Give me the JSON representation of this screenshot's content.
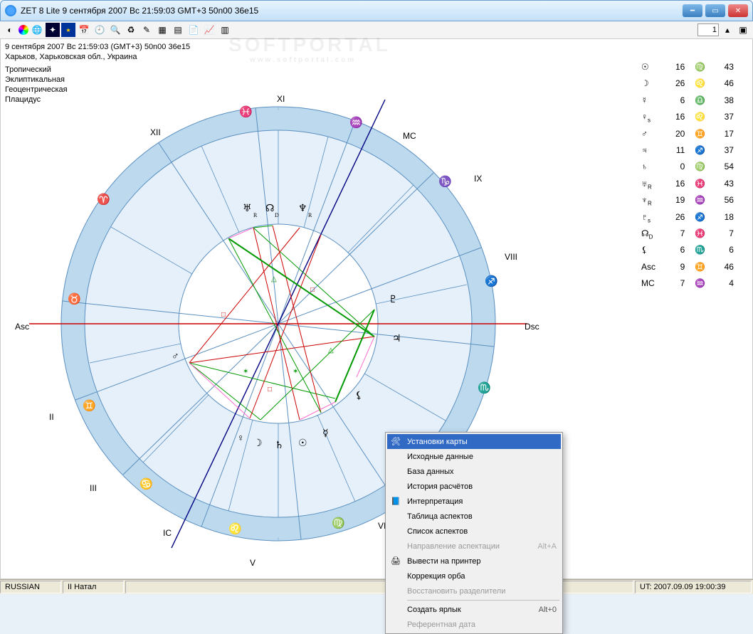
{
  "window": {
    "title": "ZET 8 Lite    9 сентября 2007   Вс   21:59:03 GMT+3 50n00  36e15"
  },
  "toolbar": {
    "page_number": "1"
  },
  "info": {
    "line1": "9 сентября 2007  Вс  21:59:03 (GMT+3)  50n00  36e15",
    "line2": "Харьков, Харьковская обл., Украина",
    "settings": [
      "Тропический",
      "Эклиптикальная",
      "Геоцентрическая",
      "Плацидус"
    ]
  },
  "watermark": {
    "big": "SOFTPORTAL",
    "sub": "www.softportal.com"
  },
  "labels": {
    "asc": "Asc",
    "dsc": "Dsc",
    "mc": "MC",
    "ic": "IC",
    "houses": {
      "II": "II",
      "III": "III",
      "V": "V",
      "VI": "VI",
      "VIII": "VIII",
      "IX": "IX",
      "XI": "XI",
      "XII": "XII"
    }
  },
  "planet_positions": [
    {
      "sym": "☉",
      "sub": "",
      "deg": "16",
      "sign": "♍",
      "min": "43"
    },
    {
      "sym": "☽",
      "sub": "",
      "deg": "26",
      "sign": "♌",
      "min": "46"
    },
    {
      "sym": "☿",
      "sub": "",
      "deg": "6",
      "sign": "♎",
      "min": "38"
    },
    {
      "sym": "♀",
      "sub": "s",
      "deg": "16",
      "sign": "♌",
      "min": "37"
    },
    {
      "sym": "♂",
      "sub": "",
      "deg": "20",
      "sign": "♊",
      "min": "17"
    },
    {
      "sym": "♃",
      "sub": "",
      "deg": "11",
      "sign": "♐",
      "min": "37"
    },
    {
      "sym": "♄",
      "sub": "",
      "deg": "0",
      "sign": "♍",
      "min": "54"
    },
    {
      "sym": "♅",
      "sub": "R",
      "deg": "16",
      "sign": "♓",
      "min": "43"
    },
    {
      "sym": "♆",
      "sub": "R",
      "deg": "19",
      "sign": "♒",
      "min": "56"
    },
    {
      "sym": "♇",
      "sub": "s",
      "deg": "26",
      "sign": "♐",
      "min": "18"
    },
    {
      "sym": "☊",
      "sub": "D",
      "deg": "7",
      "sign": "♓",
      "min": "7"
    },
    {
      "sym": "⚸",
      "sub": "",
      "deg": "6",
      "sign": "♏",
      "min": "6"
    },
    {
      "sym": "Asc",
      "sub": "",
      "deg": "9",
      "sign": "♊",
      "min": "46"
    },
    {
      "sym": "MC",
      "sub": "",
      "deg": "7",
      "sign": "♒",
      "min": "4"
    }
  ],
  "context_menu": [
    {
      "icon": "🛠",
      "label": "Установки карты",
      "selected": true
    },
    {
      "label": "Исходные данные"
    },
    {
      "label": "База данных"
    },
    {
      "label": "История расчётов"
    },
    {
      "icon": "📘",
      "label": "Интерпретация"
    },
    {
      "label": "Таблица аспектов"
    },
    {
      "label": "Список аспектов"
    },
    {
      "label": "Направление аспектации",
      "shortcut": "Alt+A",
      "disabled": true
    },
    {
      "icon": "🖨",
      "label": "Вывести на принтер"
    },
    {
      "label": "Коррекция орба"
    },
    {
      "label": "Восстановить разделители",
      "disabled": true
    },
    {
      "sep": true
    },
    {
      "label": "Создать ярлык",
      "shortcut": "Alt+0"
    },
    {
      "label": "Референтная дата",
      "disabled": true
    }
  ],
  "statusbar": {
    "lang": "RUSSIAN",
    "mode": "II Натал",
    "ut": "UT: 2007.09.09 19:00:39"
  },
  "chart_data": {
    "type": "natal_chart",
    "note": "Astrological wheel; house cusps, planet positions listed in planet_positions, zodiac ring with 12 signs, aspects drawn between planets."
  }
}
